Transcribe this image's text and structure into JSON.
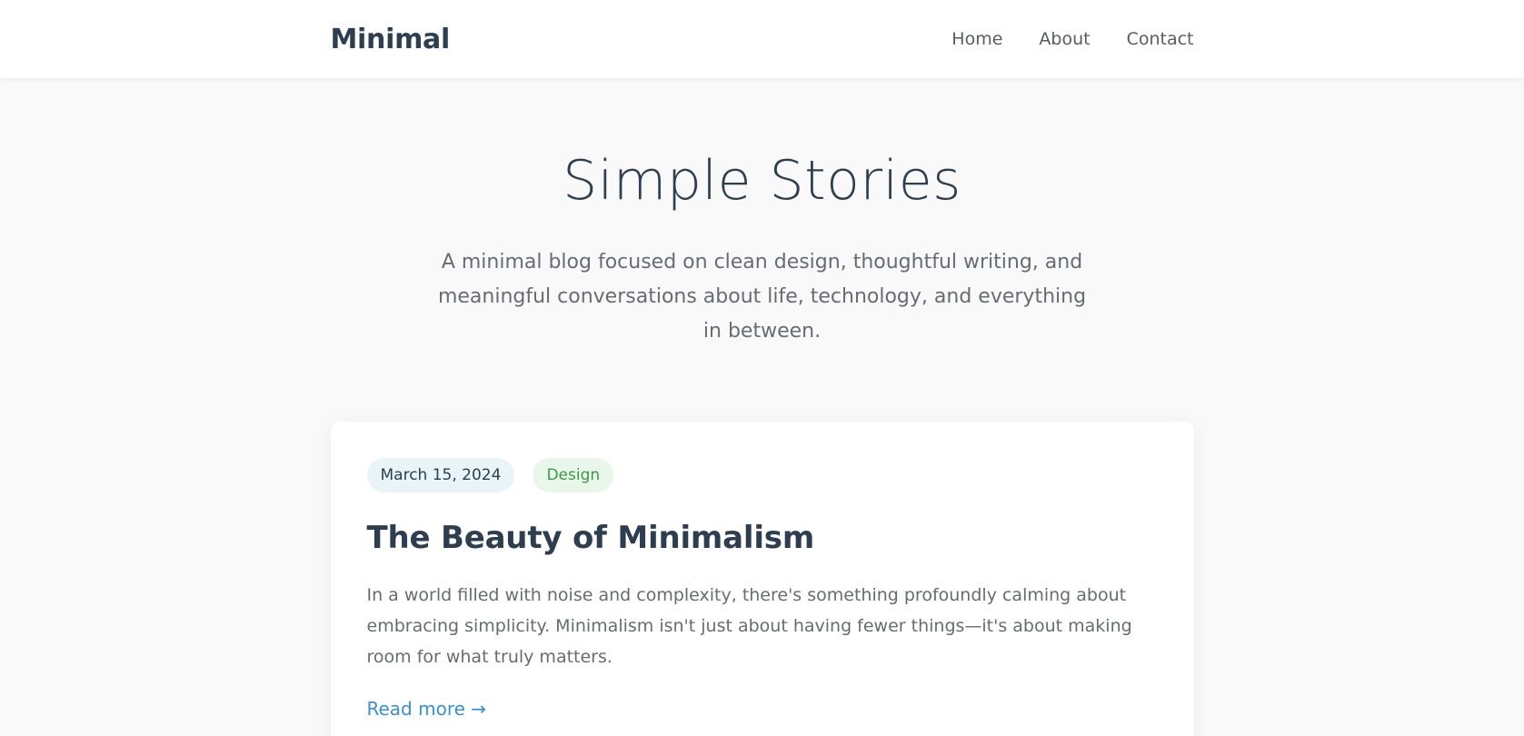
{
  "header": {
    "logo": "Minimal",
    "nav": [
      "Home",
      "About",
      "Contact"
    ]
  },
  "hero": {
    "title": "Simple Stories",
    "subtitle": "A minimal blog focused on clean design, thoughtful writing, and meaningful conversations about life, technology, and everything in between."
  },
  "posts": [
    {
      "date": "March 15, 2024",
      "tag": "Design",
      "title": "The Beauty of Minimalism",
      "excerpt": "In a world filled with noise and complexity, there's something profoundly calming about embracing simplicity. Minimalism isn't just about having fewer things—it's about making room for what truly matters.",
      "read_more": "Read more →"
    }
  ],
  "colors": {
    "accent": "#3b8fcf",
    "tag_text": "#3a9a4a",
    "heading": "#2c3e50",
    "background": "#f9f9f9"
  }
}
